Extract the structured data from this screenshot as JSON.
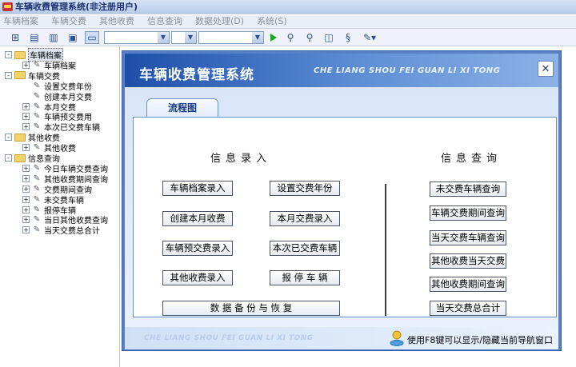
{
  "window": {
    "title": "车辆收费管理系统(非注册用户)"
  },
  "menu": [
    "车辆档案",
    "车辆交费",
    "其他收费",
    "信息查询",
    "数据处理(D)",
    "系统(S)"
  ],
  "toolbar": {
    "combo1": "",
    "combo2": "",
    "combo3": ""
  },
  "tree": [
    {
      "label": "车辆档案",
      "level": 0,
      "type": "folder",
      "expander": "-",
      "selected": true
    },
    {
      "label": "车辆档案",
      "level": 1,
      "type": "leaf",
      "expander": "+"
    },
    {
      "label": "车辆交费",
      "level": 0,
      "type": "folder",
      "expander": "-"
    },
    {
      "label": "设置交费年份",
      "level": 1,
      "type": "leaf",
      "expander": ""
    },
    {
      "label": "创建本月交费",
      "level": 1,
      "type": "leaf",
      "expander": ""
    },
    {
      "label": "本月交费",
      "level": 1,
      "type": "leaf",
      "expander": "+"
    },
    {
      "label": "车辆预交费用",
      "level": 1,
      "type": "leaf",
      "expander": "+"
    },
    {
      "label": "本次已交费车辆",
      "level": 1,
      "type": "leaf",
      "expander": "+"
    },
    {
      "label": "其他收费",
      "level": 0,
      "type": "folder",
      "expander": "-"
    },
    {
      "label": "其他收费",
      "level": 1,
      "type": "leaf",
      "expander": "+"
    },
    {
      "label": "信息查询",
      "level": 0,
      "type": "folder",
      "expander": "-"
    },
    {
      "label": "今日车辆交费查询",
      "level": 1,
      "type": "leaf",
      "expander": "+"
    },
    {
      "label": "其他收费期间查询",
      "level": 1,
      "type": "leaf",
      "expander": "+"
    },
    {
      "label": "交费期间查询",
      "level": 1,
      "type": "leaf",
      "expander": "+"
    },
    {
      "label": "未交费车辆",
      "level": 1,
      "type": "leaf",
      "expander": "+"
    },
    {
      "label": "报停车辆",
      "level": 1,
      "type": "leaf",
      "expander": "+"
    },
    {
      "label": "当日其他收费查询",
      "level": 1,
      "type": "leaf",
      "expander": "+"
    },
    {
      "label": "当天交费总合计",
      "level": 1,
      "type": "leaf",
      "expander": "+"
    }
  ],
  "main": {
    "banner_title": "车辆收费管理系统",
    "banner_subtitle": "CHE LIANG SHOU FEI GUAN LI XI TONG",
    "close_glyph": "✕",
    "tab_label": "流程图",
    "entry_section": "信息录入",
    "query_section": "信息查询",
    "entry_buttons": {
      "vehicle_record": "车辆档案录入",
      "set_year": "设置交费年份",
      "create_month": "创建本月收费",
      "month_entry": "本月交费录入",
      "prepay_entry": "车辆预交费录入",
      "paid_vehicles": "本次已交费车辆",
      "other_entry": "其他收费录入",
      "suspend": "报 停 车 辆",
      "backup": "数 据 备 份 与 恢 复"
    },
    "query_buttons": [
      "未交费车辆查询",
      "车辆交费期间查询",
      "当天交费车辆查询",
      "其他收费当天交费",
      "其他收费期间查询",
      "当天交费总合计"
    ],
    "footer_text": "CHE LIANG SHOU FEI GUAN LI XI TONG",
    "footer_tip": "使用F8键可以显示/隐藏当前导航窗口"
  }
}
